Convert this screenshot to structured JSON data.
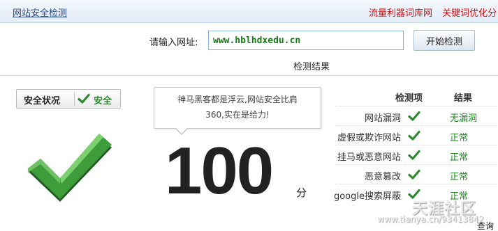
{
  "header": {
    "site_title": "网站安全检测",
    "links": [
      "流量利器词库网",
      "关键词优化分"
    ]
  },
  "form": {
    "input_label": "请输入网址:",
    "url_value": "www.hblhdxedu.cn",
    "start_button": "开始检测",
    "results_title": "检测结果"
  },
  "status": {
    "label": "安全状况",
    "value": "安全",
    "icon": "check-icon"
  },
  "bubble": {
    "line1": "神马黑客都是浮云,网站安全比肩",
    "line2": "360,实在是给力!"
  },
  "score": {
    "value": "100",
    "unit": "分"
  },
  "results": {
    "col_item": "检测项",
    "col_result": "结果",
    "rows": [
      {
        "item": "网站漏洞",
        "result": "无漏洞",
        "icon": "check-icon"
      },
      {
        "item": "虚假或欺诈网站",
        "result": "正常",
        "icon": "check-icon"
      },
      {
        "item": "挂马或恶意网站",
        "result": "正常",
        "icon": "check-icon"
      },
      {
        "item": "恶意篡改",
        "result": "正常",
        "icon": "check-icon"
      },
      {
        "item": "google搜索屏蔽",
        "result": "正常",
        "icon": "check-icon"
      }
    ]
  },
  "watermark": {
    "brand": "天涯社区",
    "url": "www.tianya.cn/93413842",
    "bottom_text": "查询"
  },
  "colors": {
    "accent_green": "#2a8a2a",
    "link_red": "#cc1111",
    "title_blue": "#2b4d8c"
  }
}
